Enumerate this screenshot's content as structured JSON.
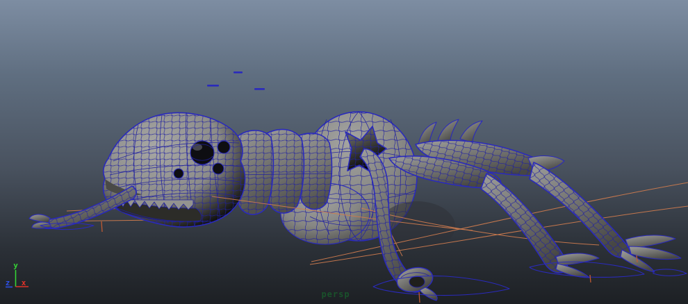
{
  "viewport": {
    "camera_label": "persp"
  },
  "axis_gizmo": {
    "y_label": "y",
    "x_label": "x",
    "z_label": "z"
  },
  "scene": {
    "model": "ant-creature-wireframe-on-shaded",
    "floating_marker_count": 3
  },
  "colors": {
    "background_top": "#7d8da2",
    "background_mid": "#49525f",
    "background_bottom": "#1d2024",
    "wireframe": "#2020a0",
    "wireframe_bright": "#2a2abc",
    "surface_light": "#a5a5a2",
    "surface_mid": "#8a8a87",
    "surface_dark": "#3f3f3d",
    "rig_curve_orange": "#cc7a4e",
    "rig_tick_orange": "#c05a32",
    "axis_y": "#35d435",
    "axis_x": "#e03228",
    "axis_z": "#2d50e8",
    "camera_label_color": "#19522b"
  }
}
